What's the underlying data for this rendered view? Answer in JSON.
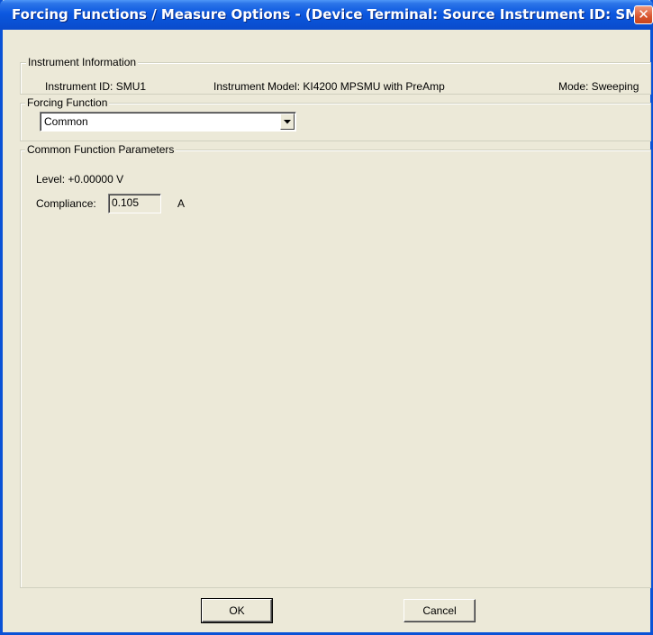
{
  "window": {
    "title": "Forcing Functions / Measure Options - (Device Terminal: Source  Instrument ID: SM…",
    "close_glyph": "✕"
  },
  "instrument_info": {
    "legend": "Instrument Information",
    "id_text": "Instrument ID:  SMU1",
    "model_text": "Instrument Model:  KI4200 MPSMU with PreAmp",
    "mode_text": "Mode:  Sweeping"
  },
  "forcing_function": {
    "legend": "Forcing Function",
    "selected": "Common"
  },
  "common_params": {
    "legend": "Common Function Parameters",
    "level_text": "Level:   +0.00000 V",
    "compliance_label": "Compliance:",
    "compliance_value": "0.105",
    "compliance_unit": "A"
  },
  "buttons": {
    "ok": "OK",
    "cancel": "Cancel"
  }
}
